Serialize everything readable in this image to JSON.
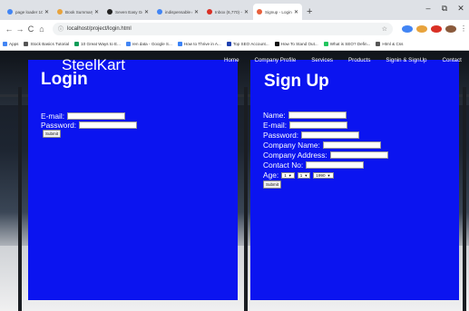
{
  "browser": {
    "tabs": [
      {
        "title": "page loader 1000 ex",
        "color": "#4285f4",
        "active": false
      },
      {
        "title": "Book Summary: The 5..",
        "color": "#e8a33c",
        "active": false
      },
      {
        "title": "Seven Easy Google Ch",
        "color": "#222222",
        "active": false
      },
      {
        "title": "indispensable epoca ci",
        "color": "#4285f4",
        "active": false
      },
      {
        "title": "Inbox (6,770) - shashi",
        "color": "#d93025",
        "active": false
      },
      {
        "title": "Signup - Login",
        "color": "#e8603c",
        "active": true
      }
    ],
    "new_tab": "+",
    "window_controls": {
      "minimize": "–",
      "restore": "⧉",
      "close": "✕"
    },
    "nav": {
      "back": "←",
      "forward": "→",
      "reload": "C",
      "home": "⌂"
    },
    "url": "localhost/project/login.html",
    "bookmarks": [
      {
        "label": "Apps",
        "color": "#4285f4"
      },
      {
        "label": "Stock Basics Tutorial",
        "color": "#555555"
      },
      {
        "label": "10 Great Ways to E...",
        "color": "#0f9d58"
      },
      {
        "label": "ren data - Google S...",
        "color": "#4285f4"
      },
      {
        "label": "How to Thrive in A...",
        "color": "#3b82f6"
      },
      {
        "label": "Top SEO Account...",
        "color": "#1e40af"
      },
      {
        "label": "How To Stand Out...",
        "color": "#111111"
      },
      {
        "label": "What is SEO? Defin...",
        "color": "#22c55e"
      },
      {
        "label": "Html & Css",
        "color": "#555555"
      }
    ]
  },
  "site": {
    "brand": "SteelKart",
    "nav": [
      "Home",
      "Company Profile",
      "Services",
      "Products",
      "Signin & SignUp",
      "Contact"
    ],
    "accent": "#0b14f0"
  },
  "login": {
    "title": "Login",
    "email_label": "E-mail:",
    "password_label": "Password:",
    "submit": "Submit"
  },
  "signup": {
    "title": "Sign Up",
    "name_label": "Name:",
    "email_label": "E-mail:",
    "password_label": "Password:",
    "company_label": "Company Name:",
    "address_label": "Company Address:",
    "contact_label": "Contact No:",
    "age_label": "Age:",
    "age_day": "1",
    "age_month": "1",
    "age_year": "1990",
    "submit": "Submit"
  }
}
